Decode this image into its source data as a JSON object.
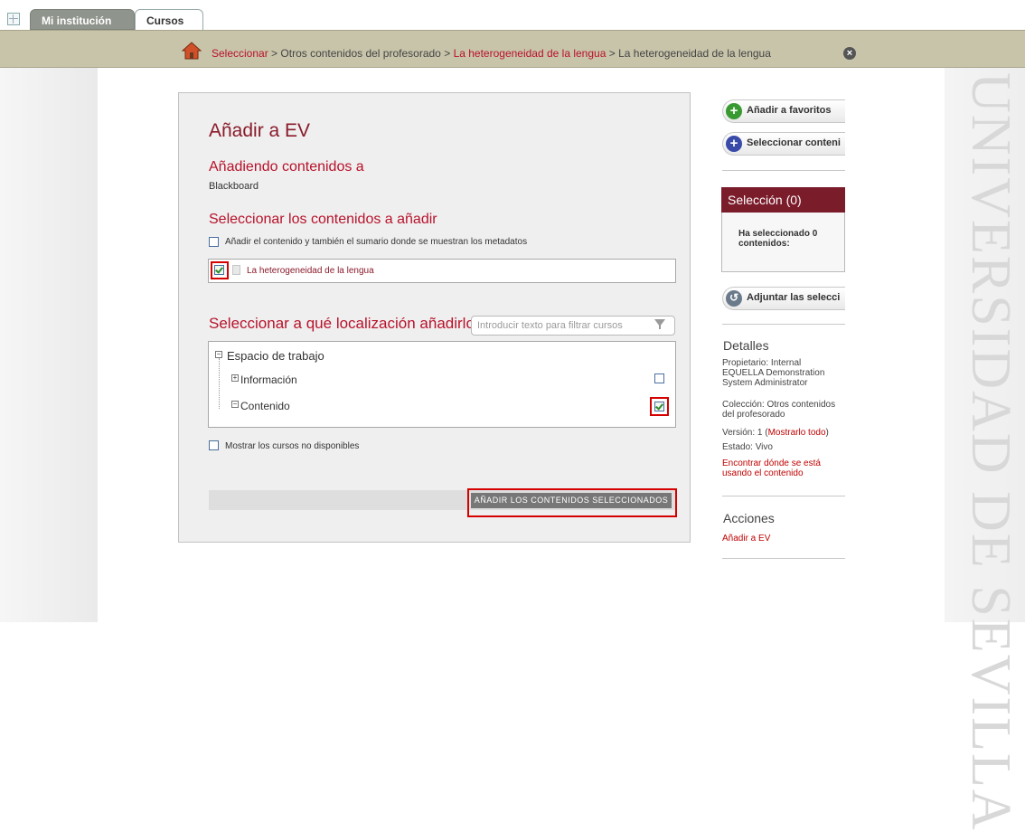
{
  "tabs": [
    {
      "label": "Mi institución"
    },
    {
      "label": "Cursos"
    }
  ],
  "breadcrumb": {
    "items": [
      "Seleccionar",
      "Otros contenidos del profesorado",
      "La heterogeneidad de la lengua",
      "La heterogeneidad de la lengua"
    ],
    "separator": ">"
  },
  "main": {
    "title": "Añadir a EV",
    "adding_heading": "Añadiendo contenidos a",
    "adding_target": "Blackboard",
    "select_heading": "Seleccionar los contenidos a añadir",
    "summary_option": "Añadir el contenido y también el sumario donde se muestran los metadatos",
    "summary_checked": false,
    "content_item": "La heterogeneidad de la lengua",
    "content_checked": true,
    "location_heading": "Seleccionar a qué localización añadirlo",
    "filter_placeholder": "Introducir texto para filtrar cursos",
    "tree": {
      "root": "Espacio de trabajo",
      "children": [
        {
          "label": "Información",
          "checked": false
        },
        {
          "label": "Contenido",
          "checked": true
        }
      ]
    },
    "show_unavailable": "Mostrar los cursos no disponibles",
    "show_unavailable_checked": false,
    "submit_label": "AÑADIR LOS CONTENIDOS SELECCIONADOS"
  },
  "sidebar": {
    "add_favorites": "Añadir a favoritos",
    "select_content": "Seleccionar conteni",
    "selection_title": "Selección (0)",
    "selection_text": "Ha seleccionado 0 contenidos:",
    "attach_label": "Adjuntar las selecci",
    "details_title": "Detalles",
    "owner_lines": [
      "Propietario: Internal",
      "EQUELLA Demonstration",
      "System Administrator"
    ],
    "collection_lines": [
      "Colección: Otros contenidos",
      "del profesorado"
    ],
    "version_prefix": "Versión: 1 (",
    "version_link": "Mostrarlo todo",
    "version_suffix": ")",
    "status": "Estado: Vivo",
    "find_usage_lines": [
      "Encontrar dónde se está",
      "usando el contenido"
    ],
    "actions_title": "Acciones",
    "action_add": "Añadir a EV"
  },
  "watermark": "UNIVERSIDAD DE SEVILLA",
  "colors": {
    "accent": "#b8122b",
    "title": "#8a1b2b",
    "selection_header": "#7b1c2b",
    "breadcrumb_bar": "#c8c4aa",
    "highlight": "#d50000"
  }
}
